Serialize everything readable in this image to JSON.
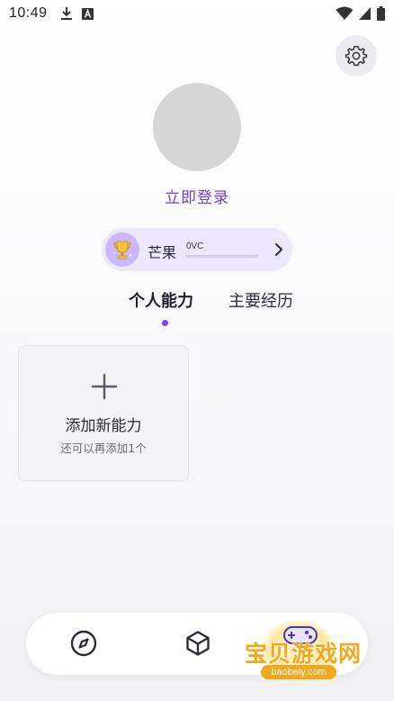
{
  "status_bar": {
    "time": "10:49",
    "icons": [
      "download-icon",
      "font-a-icon",
      "wifi-icon",
      "signal-icon",
      "battery-icon"
    ]
  },
  "header": {
    "settings_icon": "gear-icon"
  },
  "profile": {
    "login_label": "立即登录"
  },
  "mango_card": {
    "label": "芒果",
    "vc_value": "0VC",
    "vc_progress": 0,
    "icon": "trophy-icon"
  },
  "tabs": [
    {
      "label": "个人能力",
      "active": true
    },
    {
      "label": "主要经历",
      "active": false
    }
  ],
  "add_ability": {
    "title": "添加新能力",
    "subtitle": "还可以再添加1个"
  },
  "bottom_nav": {
    "items": [
      {
        "icon": "compass-icon"
      },
      {
        "icon": "cube-icon"
      }
    ]
  },
  "watermark": {
    "text": "宝贝游戏网",
    "url": "baobeiy.com"
  },
  "colors": {
    "accent": "#7b4ae6",
    "link": "#6e3dd6",
    "card_bg": "#ece7fb",
    "watermark": "#f2a81d"
  }
}
